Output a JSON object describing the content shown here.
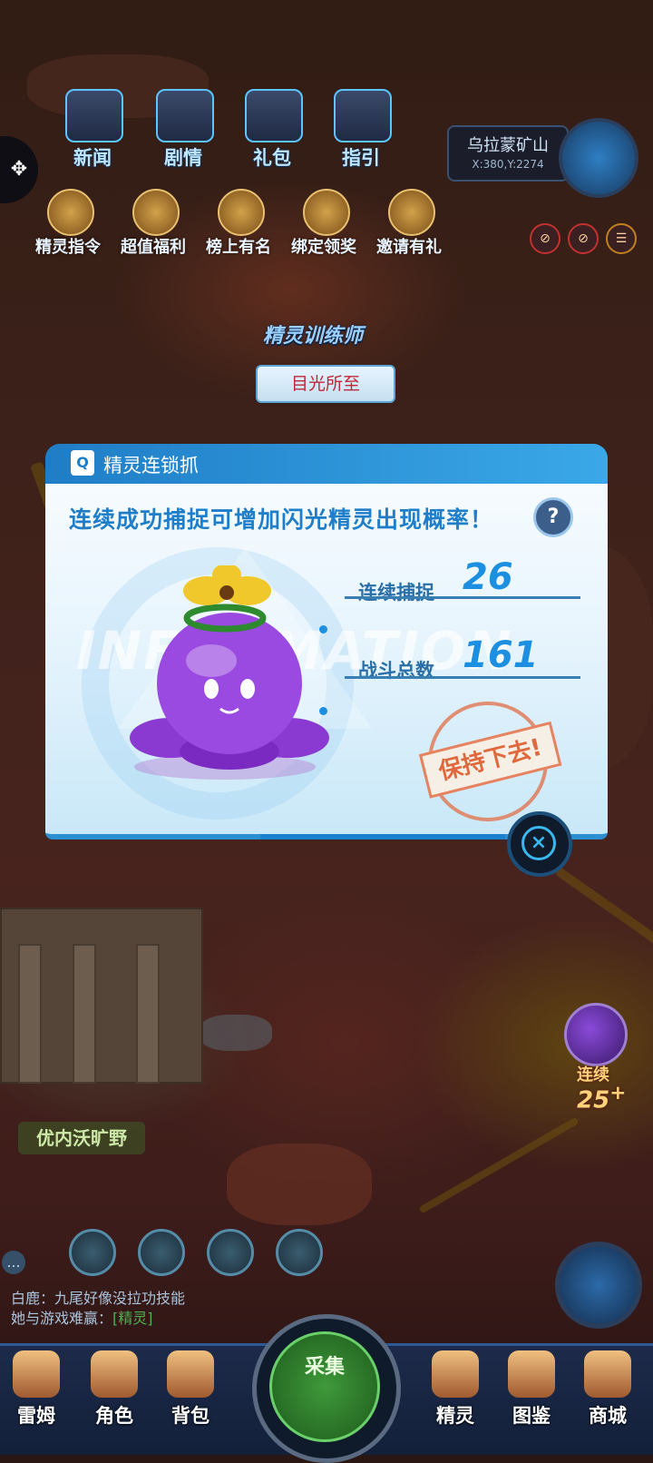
{
  "top_menu": [
    {
      "label": "新闻",
      "name": "news-button"
    },
    {
      "label": "剧情",
      "name": "story-button"
    },
    {
      "label": "礼包",
      "name": "gift-pack-button"
    },
    {
      "label": "指引",
      "name": "guide-button"
    }
  ],
  "activities": [
    {
      "label": "精灵指令",
      "name": "sprite-command-button"
    },
    {
      "label": "超值福利",
      "name": "value-welfare-button"
    },
    {
      "label": "榜上有名",
      "name": "leaderboard-button"
    },
    {
      "label": "绑定领奖",
      "name": "bind-reward-button"
    },
    {
      "label": "邀请有礼",
      "name": "invite-reward-button"
    }
  ],
  "location": {
    "name": "乌拉蒙矿山",
    "coords": "X:380,Y:2274"
  },
  "world": {
    "trainer_title": "精灵训练师",
    "trainer_name": "目光所至",
    "area_name": "优内沃旷野"
  },
  "modal": {
    "title": "精灵连锁抓",
    "subtitle": "连续成功捕捉可增加闪光精灵出现概率！",
    "help": "?",
    "watermark": "INFORMATION",
    "stats": [
      {
        "label": "连续捕捉",
        "value": "26"
      },
      {
        "label": "战斗总数",
        "value": "161"
      }
    ],
    "stamp": "保持下去!",
    "close": "×"
  },
  "streak": {
    "label": "连续",
    "value": "25",
    "suffix": "+"
  },
  "chat": {
    "line1": "白鹿：九尾好像没拉功技能",
    "line2_prefix": "她与游戏难赢：",
    "line2_highlight": "[精灵]"
  },
  "nav": [
    {
      "label": "雷姆",
      "name": "nav-leim"
    },
    {
      "label": "角色",
      "name": "nav-character"
    },
    {
      "label": "背包",
      "name": "nav-bag"
    },
    {
      "label": "精灵",
      "name": "nav-sprite"
    },
    {
      "label": "图鉴",
      "name": "nav-codex"
    },
    {
      "label": "商城",
      "name": "nav-shop"
    }
  ],
  "collect_button": "采集",
  "colors": {
    "accent": "#1d8fe0",
    "stamp": "#e0683c",
    "modal_header": "#1f7dc6"
  }
}
